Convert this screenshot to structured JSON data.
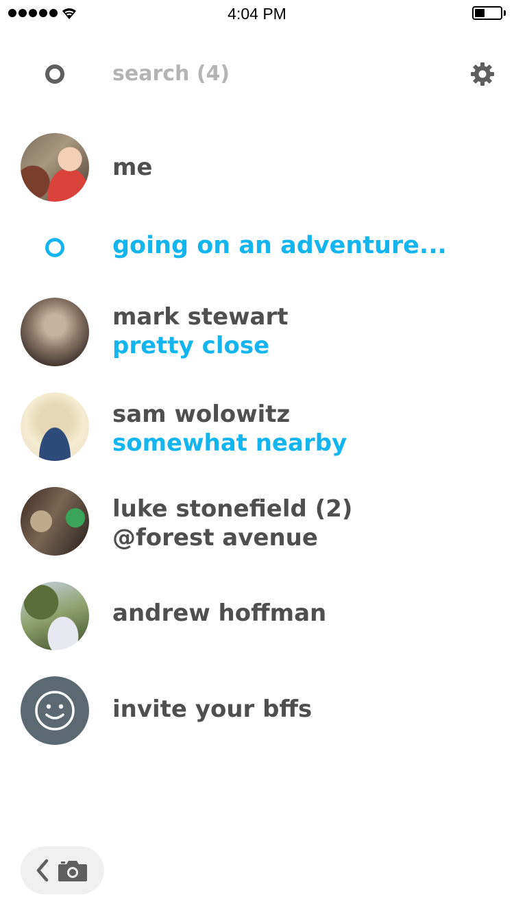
{
  "status_bar": {
    "time": "4:04 PM"
  },
  "search": {
    "placeholder": "search (4)",
    "value": ""
  },
  "icons": {
    "search": "ring-icon",
    "settings": "gear-icon",
    "adventure": "ring-icon",
    "invite": "smiley-icon",
    "back": "chevron-left-icon",
    "camera": "camera-icon"
  },
  "colors": {
    "accent": "#14b5ef",
    "text": "#4f4f4f",
    "placeholder": "#b4b4b4",
    "invite_avatar": "#5b6a71"
  },
  "me": {
    "label": "me"
  },
  "adventure": {
    "label": "going on an adventure..."
  },
  "friends": [
    {
      "name": "mark stewart",
      "status": "pretty close"
    },
    {
      "name": "sam wolowitz",
      "status": "somewhat nearby"
    },
    {
      "name": "luke stonefield (2)",
      "status": "@forest avenue"
    },
    {
      "name": "andrew hoffman"
    }
  ],
  "invite": {
    "label": "invite your bffs"
  }
}
